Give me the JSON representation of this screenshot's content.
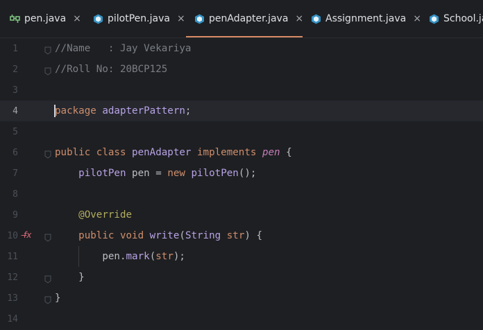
{
  "tabs": [
    {
      "name": "pen.java",
      "icon": "interface-icon",
      "active": false
    },
    {
      "name": "pilotPen.java",
      "icon": "class-icon",
      "active": false
    },
    {
      "name": "penAdapter.java",
      "icon": "class-icon",
      "active": true
    },
    {
      "name": "Assignment.java",
      "icon": "class-icon",
      "active": false
    },
    {
      "name": "School.ja",
      "icon": "class-icon",
      "active": false
    }
  ],
  "close_glyph": "×",
  "colors": {
    "background": "#1e1f22",
    "keyword": "#cf8e6d",
    "comment": "#7a7e85",
    "method": "#56a8f5",
    "interface_name": "#c77dbb",
    "annotation": "#b3ae60",
    "active_tab_underline": "#d98a65"
  },
  "editor": {
    "current_line": 4,
    "lines": [
      {
        "num": "1",
        "tokens": [
          {
            "t": "//Name   : Jay Vekariya",
            "c": "cm"
          }
        ]
      },
      {
        "num": "2",
        "tokens": [
          {
            "t": "//Roll No: 20BCP125",
            "c": "cm"
          }
        ]
      },
      {
        "num": "3",
        "tokens": []
      },
      {
        "num": "4",
        "tokens": [
          {
            "t": "package",
            "c": "kw"
          },
          {
            "t": " adapterPattern",
            "c": "pk"
          },
          {
            "t": ";",
            "c": "plain"
          }
        ]
      },
      {
        "num": "5",
        "tokens": []
      },
      {
        "num": "6",
        "tokens": [
          {
            "t": "public class ",
            "c": "kw"
          },
          {
            "t": "penAdapter",
            "c": "pk"
          },
          {
            "t": " implements ",
            "c": "kw"
          },
          {
            "t": "pen",
            "c": "iname"
          },
          {
            "t": " {",
            "c": "plain"
          }
        ]
      },
      {
        "num": "7",
        "tokens": [
          {
            "t": "    pilotPen",
            "c": "pk"
          },
          {
            "t": " pen ",
            "c": "plain"
          },
          {
            "t": "= ",
            "c": "plain"
          },
          {
            "t": "new ",
            "c": "kw"
          },
          {
            "t": "pilotPen",
            "c": "pk"
          },
          {
            "t": "();",
            "c": "plain"
          }
        ]
      },
      {
        "num": "8",
        "tokens": []
      },
      {
        "num": "9",
        "tokens": [
          {
            "t": "    @Override",
            "c": "ann"
          }
        ]
      },
      {
        "num": "10",
        "tokens": [
          {
            "t": "    public void ",
            "c": "kw"
          },
          {
            "t": "write",
            "c": "pk"
          },
          {
            "t": "(",
            "c": "plain"
          },
          {
            "t": "String",
            "c": "pk"
          },
          {
            "t": " ",
            "c": "plain"
          },
          {
            "t": "str",
            "c": "kw"
          },
          {
            "t": ") {",
            "c": "plain"
          }
        ]
      },
      {
        "num": "11",
        "tokens": [
          {
            "t": "        pen",
            "c": "plain"
          },
          {
            "t": ".",
            "c": "plain"
          },
          {
            "t": "mark",
            "c": "pk"
          },
          {
            "t": "(",
            "c": "plain"
          },
          {
            "t": "str",
            "c": "kw"
          },
          {
            "t": ");",
            "c": "plain"
          }
        ]
      },
      {
        "num": "12",
        "tokens": [
          {
            "t": "    }",
            "c": "plain"
          }
        ]
      },
      {
        "num": "13",
        "tokens": [
          {
            "t": "}",
            "c": "plain"
          }
        ]
      },
      {
        "num": "14",
        "tokens": []
      }
    ],
    "gutter_marks": [
      {
        "line": 10,
        "icon": "override-method-icon",
        "glyph": "f̶x"
      }
    ]
  }
}
